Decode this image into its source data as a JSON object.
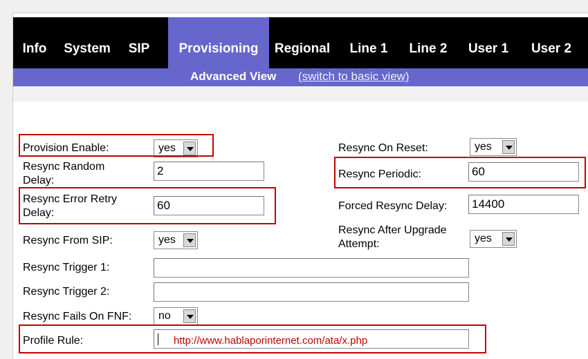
{
  "tabs": [
    "Info",
    "System",
    "SIP",
    "Provisioning",
    "Regional",
    "Line 1",
    "Line 2",
    "User 1",
    "User 2"
  ],
  "active_tab": "Provisioning",
  "view": {
    "label": "Advanced View",
    "switch_link": "(switch to basic view)"
  },
  "fields": {
    "provision_enable": {
      "label": "Provision Enable:",
      "value": "yes"
    },
    "resync_random_delay": {
      "label": "Resync Random Delay:",
      "value": "2"
    },
    "resync_error_retry_delay": {
      "label": "Resync Error Retry Delay:",
      "value": "60"
    },
    "resync_from_sip": {
      "label": "Resync From SIP:",
      "value": "yes"
    },
    "resync_trigger_1": {
      "label": "Resync Trigger 1:",
      "value": ""
    },
    "resync_trigger_2": {
      "label": "Resync Trigger 2:",
      "value": ""
    },
    "resync_fails_on_fnf": {
      "label": "Resync Fails On FNF:",
      "value": "no"
    },
    "profile_rule": {
      "label": "Profile Rule:",
      "value": "http://www.hablaporinternet.com/ata/x.php"
    },
    "resync_on_reset": {
      "label": "Resync On Reset:",
      "value": "yes"
    },
    "resync_periodic": {
      "label": "Resync Periodic:",
      "value": "60"
    },
    "forced_resync_delay": {
      "label": "Forced Resync Delay:",
      "value": "14400"
    },
    "resync_after_upgrade_attempt": {
      "label": "Resync After Upgrade Attempt:",
      "value": "yes"
    }
  },
  "colors": {
    "tabbar": "#000000",
    "active_tab": "#6666cc",
    "highlight": "#c00000"
  }
}
